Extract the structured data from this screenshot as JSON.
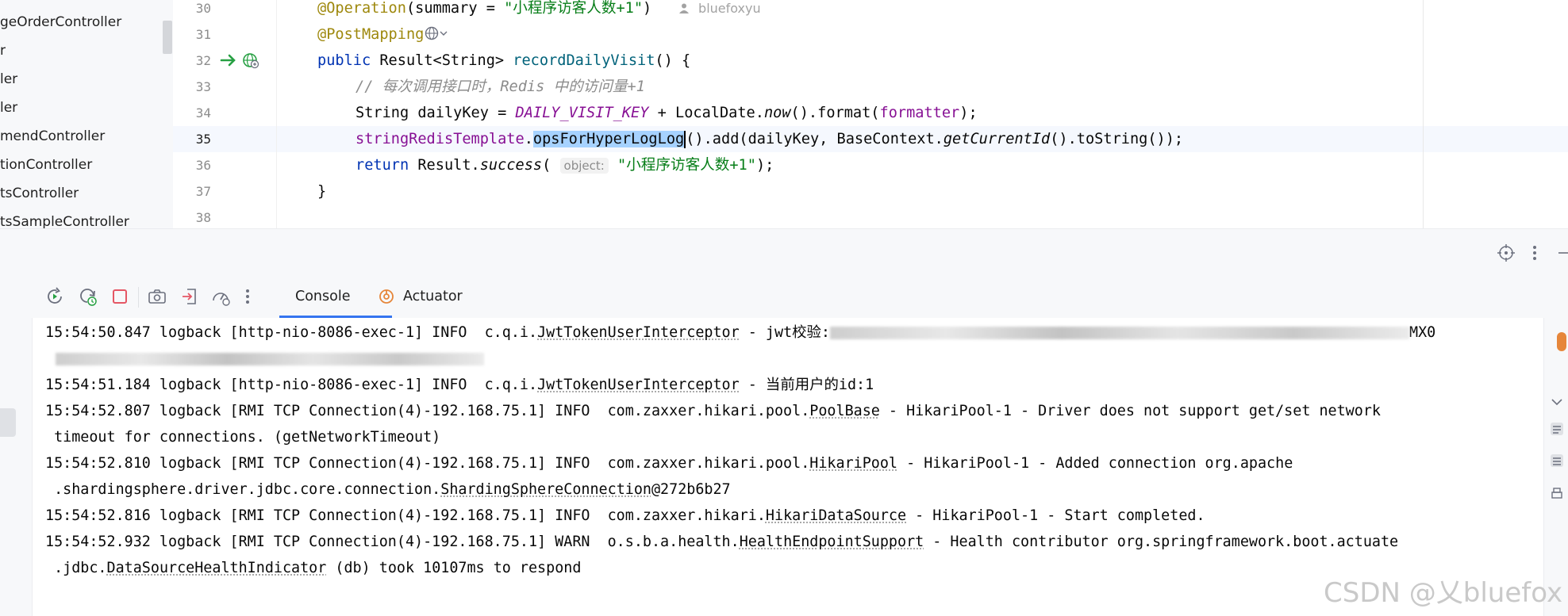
{
  "project_tree": {
    "items": [
      "geOrderController",
      "r",
      "ler",
      "ler",
      "mendController",
      "tionController",
      "tsController",
      "tsSampleController"
    ]
  },
  "editor": {
    "line_numbers": [
      "30",
      "31",
      "32",
      "33",
      "34",
      "35",
      "36",
      "37",
      "38"
    ],
    "line30": {
      "annotation": "@Operation",
      "pre": "(summary = ",
      "string": "\"小程序访客人数+1\"",
      "post": ")",
      "author": "bluefoxyu"
    },
    "line31": {
      "annotation": "@PostMapping"
    },
    "line32": {
      "kw": "public",
      "type": " Result<String> ",
      "method": "recordDailyVisit",
      "rest": "() {"
    },
    "line33": {
      "comment": "// 每次调用接口时，Redis 中的访问量+1"
    },
    "line34": {
      "pre": "String dailyKey = ",
      "const": "DAILY_VISIT_KEY",
      "mid": " + LocalDate.",
      "now": "now",
      "mid2": "().format(",
      "field": "formatter",
      "post": ");"
    },
    "line35": {
      "field": "stringRedisTemplate",
      "dot": ".",
      "selected": "opsForHyperLogLog",
      "rest": "().add(dailyKey, BaseContext.",
      "getid": "getCurrentId",
      "post": "().toString());"
    },
    "line36": {
      "kw": "return",
      "pre": " Result.",
      "success": "success",
      "open": "(",
      "hint": "object:",
      "string": "\"小程序访客人数+1\"",
      "post": ");"
    },
    "line37": {
      "text": "}"
    }
  },
  "tool_window": {
    "tabs": [
      {
        "label": "Console",
        "active": true
      },
      {
        "label": "Actuator",
        "active": false
      }
    ]
  },
  "console": {
    "lines": [
      {
        "prefix": "15:54:50.847 logback [http-nio-8086-exec-1] INFO  c.q.i.",
        "link": "JwtTokenUserInterceptor",
        "suffix": " - jwt校验:",
        "tail": "MX0"
      },
      {
        "text": ""
      },
      {
        "prefix": "15:54:51.184 logback [http-nio-8086-exec-1] INFO  c.q.i.",
        "link": "JwtTokenUserInterceptor",
        "suffix": " - 当前用户的id:1"
      },
      {
        "prefix": "15:54:52.807 logback [RMI TCP Connection(4)-192.168.75.1] INFO  com.zaxxer.hikari.pool.",
        "link": "PoolBase",
        "suffix": " - HikariPool-1 - Driver does not support get/set network"
      },
      {
        "text": " timeout for connections. (getNetworkTimeout)"
      },
      {
        "prefix": "15:54:52.810 logback [RMI TCP Connection(4)-192.168.75.1] INFO  com.zaxxer.hikari.pool.",
        "link": "HikariPool",
        "suffix": " - HikariPool-1 - Added connection org.apache"
      },
      {
        "prefix": " .shardingsphere.driver.jdbc.core.connection.",
        "link": "ShardingSphereConnection",
        "suffix": "@272b6b27"
      },
      {
        "prefix": "15:54:52.816 logback [RMI TCP Connection(4)-192.168.75.1] INFO  com.zaxxer.hikari.",
        "link": "HikariDataSource",
        "suffix": " - HikariPool-1 - Start completed."
      },
      {
        "prefix": "15:54:52.932 logback [RMI TCP Connection(4)-192.168.75.1] WARN  o.s.b.a.health.",
        "link": "HealthEndpointSupport",
        "suffix": " - Health contributor org.springframework.boot.actuate"
      },
      {
        "prefix": " .jdbc.",
        "link": "DataSourceHealthIndicator",
        "suffix": " (db) took 10107ms to respond"
      }
    ]
  },
  "watermark": "CSDN @乂bluefox",
  "colors": {
    "accent": "#3574f0",
    "selection": "#a6d2ff",
    "run_arrow": "#27a043",
    "stop": "#e55765"
  }
}
